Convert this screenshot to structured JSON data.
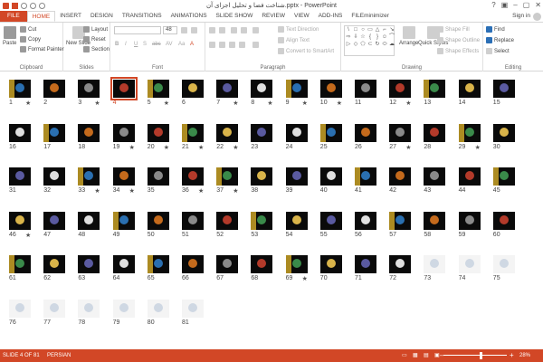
{
  "window": {
    "title": "شناخت فضا و تحلیل اجزای آن.pptx - PowerPoint",
    "controls": [
      "?",
      "▣",
      "–",
      "▢",
      "✕"
    ]
  },
  "ribbon_tabs": [
    "FILE",
    "HOME",
    "INSERT",
    "DESIGN",
    "TRANSITIONS",
    "ANIMATIONS",
    "SLIDE SHOW",
    "REVIEW",
    "VIEW",
    "ADD-INS",
    "FILEminimizer"
  ],
  "active_tab": "HOME",
  "account": {
    "sign_in": "Sign in"
  },
  "ribbon": {
    "clipboard": {
      "label": "Clipboard",
      "paste": "Paste",
      "cut": "Cut",
      "copy": "Copy",
      "format_painter": "Format Painter"
    },
    "slides": {
      "label": "Slides",
      "new_slide": "New Slide",
      "layout": "Layout",
      "reset": "Reset",
      "section": "Section"
    },
    "font": {
      "label": "Font",
      "font_size": "48",
      "font_buttons": [
        "B",
        "I",
        "U",
        "S",
        "abc",
        "AV",
        "Aa",
        "A"
      ]
    },
    "paragraph": {
      "label": "Paragraph",
      "text_direction": "Text Direction",
      "align_text": "Align Text",
      "convert_smartart": "Convert to SmartArt"
    },
    "drawing": {
      "label": "Drawing",
      "arrange": "Arrange",
      "quick_styles": "Quick Styles",
      "shape_fill": "Shape Fill",
      "shape_outline": "Shape Outline",
      "shape_effects": "Shape Effects",
      "shapes": [
        "\\",
        "□",
        "○",
        "▭",
        "△",
        "⌐",
        "↘",
        "⇨",
        "⇩",
        "☆",
        "{",
        "}",
        "☺",
        "⌒",
        "▷",
        "◇",
        "⬠",
        "⊂",
        "↻",
        "⬭",
        "☁"
      ]
    },
    "editing": {
      "label": "Editing",
      "find": "Find",
      "replace": "Replace",
      "select": "Select"
    }
  },
  "slides": [
    {
      "n": "1",
      "star": true
    },
    {
      "n": "2",
      "star": false
    },
    {
      "n": "3",
      "star": true
    },
    {
      "n": "4",
      "star": false,
      "selected": true
    },
    {
      "n": "5",
      "star": true
    },
    {
      "n": "6",
      "star": false
    },
    {
      "n": "7",
      "star": true
    },
    {
      "n": "8",
      "star": true
    },
    {
      "n": "9",
      "star": true
    },
    {
      "n": "10",
      "star": true
    },
    {
      "n": "11",
      "star": false
    },
    {
      "n": "12",
      "star": true
    },
    {
      "n": "13",
      "star": false
    },
    {
      "n": "14",
      "star": false
    },
    {
      "n": "15",
      "star": false
    },
    {
      "n": "16",
      "star": false
    },
    {
      "n": "17",
      "star": false
    },
    {
      "n": "18",
      "star": false
    },
    {
      "n": "19",
      "star": true
    },
    {
      "n": "20",
      "star": true
    },
    {
      "n": "21",
      "star": true
    },
    {
      "n": "22",
      "star": true
    },
    {
      "n": "23",
      "star": false
    },
    {
      "n": "24",
      "star": false
    },
    {
      "n": "25",
      "star": false
    },
    {
      "n": "26",
      "star": false
    },
    {
      "n": "27",
      "star": true
    },
    {
      "n": "28",
      "star": false
    },
    {
      "n": "29",
      "star": true
    },
    {
      "n": "30",
      "star": false
    },
    {
      "n": "31",
      "star": false
    },
    {
      "n": "32",
      "star": false
    },
    {
      "n": "33",
      "star": true
    },
    {
      "n": "34",
      "star": true
    },
    {
      "n": "35",
      "star": false
    },
    {
      "n": "36",
      "star": true
    },
    {
      "n": "37",
      "star": true
    },
    {
      "n": "38",
      "star": false
    },
    {
      "n": "39",
      "star": false
    },
    {
      "n": "40",
      "star": false
    },
    {
      "n": "41",
      "star": false
    },
    {
      "n": "42",
      "star": false
    },
    {
      "n": "43",
      "star": false
    },
    {
      "n": "44",
      "star": false
    },
    {
      "n": "45",
      "star": false
    },
    {
      "n": "46",
      "star": true
    },
    {
      "n": "47",
      "star": false
    },
    {
      "n": "48",
      "star": false
    },
    {
      "n": "49",
      "star": false
    },
    {
      "n": "50",
      "star": false
    },
    {
      "n": "51",
      "star": false
    },
    {
      "n": "52",
      "star": false
    },
    {
      "n": "53",
      "star": false
    },
    {
      "n": "54",
      "star": false
    },
    {
      "n": "55",
      "star": false
    },
    {
      "n": "56",
      "star": false
    },
    {
      "n": "57",
      "star": false
    },
    {
      "n": "58",
      "star": false
    },
    {
      "n": "59",
      "star": false
    },
    {
      "n": "60",
      "star": false
    },
    {
      "n": "61",
      "star": false
    },
    {
      "n": "62",
      "star": false
    },
    {
      "n": "63",
      "star": false
    },
    {
      "n": "64",
      "star": false
    },
    {
      "n": "65",
      "star": false
    },
    {
      "n": "66",
      "star": false
    },
    {
      "n": "67",
      "star": false
    },
    {
      "n": "68",
      "star": false
    },
    {
      "n": "69",
      "star": true
    },
    {
      "n": "70",
      "star": false
    },
    {
      "n": "71",
      "star": false
    },
    {
      "n": "72",
      "star": false
    },
    {
      "n": "73",
      "star": false
    },
    {
      "n": "74",
      "star": false
    },
    {
      "n": "75",
      "star": false
    },
    {
      "n": "76",
      "star": false
    },
    {
      "n": "77",
      "star": false
    },
    {
      "n": "78",
      "star": false
    },
    {
      "n": "79",
      "star": false
    },
    {
      "n": "80",
      "star": false
    },
    {
      "n": "81",
      "star": false
    }
  ],
  "star_glyph": "★",
  "statusbar": {
    "slide_info": "SLIDE 4 OF 81",
    "language": "PERSIAN",
    "zoom": "28%",
    "zoom_minus": "–",
    "zoom_plus": "+"
  },
  "colors": {
    "accent": "#d24726"
  }
}
